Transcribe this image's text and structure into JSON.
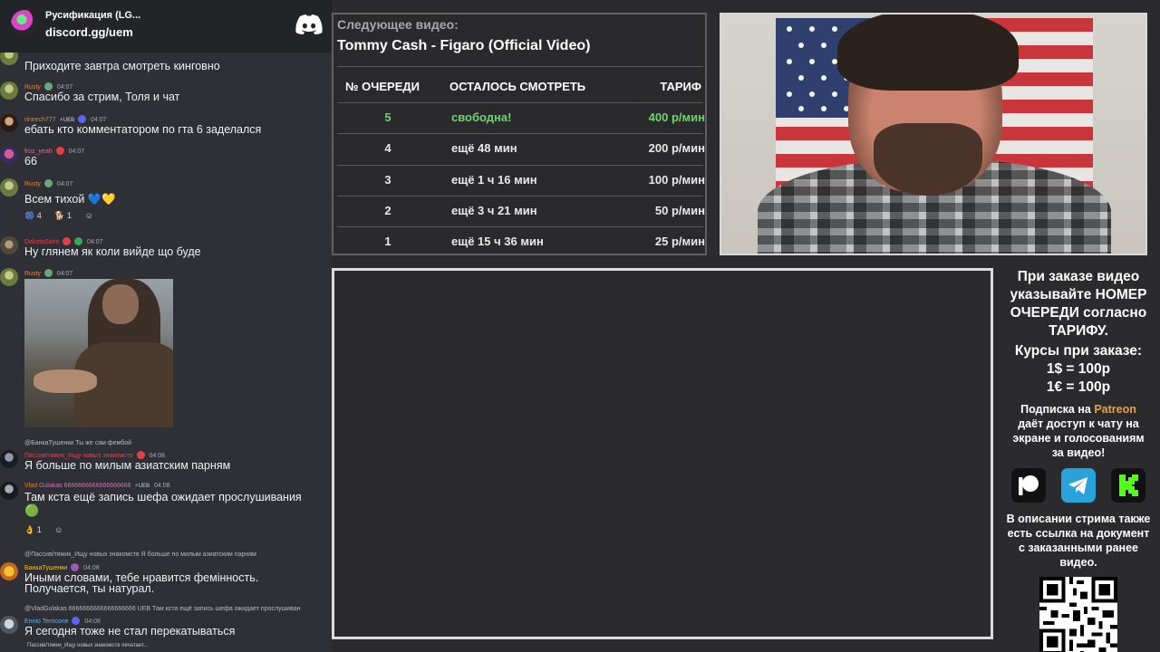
{
  "chat": {
    "server_name": "Русификация (LG...",
    "invite": "discord.gg/uem",
    "messages": [
      {
        "text": "Приходите завтра смотреть кинговно"
      },
      {
        "user": "Rusty",
        "time": "04:07",
        "text": "Спасибо за стрим, Толя и чат"
      },
      {
        "user": "rineech777",
        "tag": "UEB",
        "time": "04:07",
        "text": "ебать кто комментатором по гта 6 заделался"
      },
      {
        "user": "froz_yeah",
        "time": "04:07",
        "text": "66"
      },
      {
        "user": "Rusty",
        "time": "04:07",
        "text": "Всем тихой 💙💛",
        "reactions": [
          "4",
          "1"
        ]
      },
      {
        "user": "DakotaSaint",
        "time": "04:07",
        "text": "Ну глянем як коли вийде що буде"
      },
      {
        "user": "Rusty",
        "time": "04:07"
      },
      {
        "reply": "@БанкаТушенки Ты же сам фембой",
        "user": "Пассив/тяжик_Ищу новых знакомств",
        "time": "04:08",
        "text": "Я больше по милым азиатским парням"
      },
      {
        "user": "Vlad",
        "user_extra": "Gulakas 6666666666666666666",
        "tag": "UEB",
        "time": "04:08",
        "text": "Там кста ещё запись шефа ожидает прослушивания",
        "reactions": [
          "1"
        ]
      },
      {
        "reply": "@Пассив/тяжик_Ищу новых знакомств Я больше по милым азиатским парням",
        "user": "БанкаТушенки",
        "time": "04:08",
        "text": "Иными словами, тебе нравится фемінность.",
        "text2": "Получается, ты натурал."
      },
      {
        "reply": "@VladGulakas 6666666666666666666 UEB Там кста ещё запись шефа ожидает прослушиван",
        "user": "Ennio Terricone",
        "time": "04:08",
        "text": "Я сегодня тоже не стал перекатываться"
      }
    ],
    "typing": "Пассив/тяжик_Ищу новых знакомств печатает..."
  },
  "queue": {
    "next_label": "Следующее видео:",
    "next_title": "Tommy Cash - Figaro (Official Video)",
    "headers": {
      "num": "№ ОЧЕРЕДИ",
      "left": "ОСТАЛОСЬ СМОТРЕТЬ",
      "rate": "ТАРИФ"
    },
    "rows": [
      {
        "num": "5",
        "left": "свободна!",
        "rate": "400 р/мин",
        "status": "free"
      },
      {
        "num": "4",
        "left": "ещё 48 мин",
        "rate": "200 р/мин",
        "status": "busy"
      },
      {
        "num": "3",
        "left": "ещё 1 ч 16 мин",
        "rate": "100 р/мин",
        "status": "busy"
      },
      {
        "num": "2",
        "left": "ещё 3 ч 21 мин",
        "rate": "50 р/мин",
        "status": "busy"
      },
      {
        "num": "1",
        "left": "ещё 15 ч 36 мин",
        "rate": "25 р/мин",
        "status": "busy"
      }
    ],
    "colors": {
      "free": "#6fd56d",
      "busy": "#e9e9ea"
    }
  },
  "info": {
    "order_lines": [
      "При заказе видео",
      "указывайте НОМЕР",
      "ОЧЕРЕДИ согласно",
      "ТАРИФУ."
    ],
    "rates_title": "Курсы при заказе:",
    "rate_usd": "1$ = 100р",
    "rate_eur": "1€ = 100р",
    "sub_prefix": "Подписка на",
    "sub_brand": "Patreon",
    "sub_rest": [
      "даёт доступ к чату на",
      "экране и голосованиям",
      "за видео!"
    ],
    "desc_lines": [
      "В описании стрима также",
      "есть ссылка на документ",
      "с заказанными ранее",
      "видео."
    ],
    "social": [
      "patreon-icon",
      "telegram-icon",
      "kick-icon"
    ]
  }
}
